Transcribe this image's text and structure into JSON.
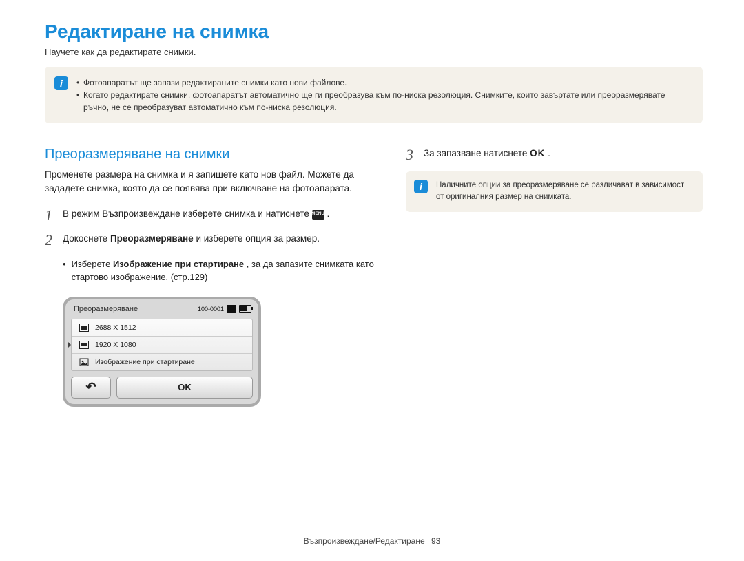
{
  "title": "Редактиране на снимка",
  "subtitle": "Научете как да редактирате снимки.",
  "top_note": {
    "items": [
      "Фотоапаратът ще запази редактираните снимки като нови файлове.",
      "Когато редактирате снимки, фотоапаратът автоматично ще ги преобразува към по-ниска резолюция. Снимките, които завъртате или преоразмерявате ръчно, не се преобразуват автоматично към по-ниска резолюция."
    ]
  },
  "left": {
    "section_title": "Преоразмеряване на снимки",
    "intro": "Променете размера на снимка и я запишете като нов файл. Можете да зададете снимка, която да се появява при включване на фотоапарата.",
    "step1_pre": "В режим Възпроизвеждане изберете снимка и натиснете ",
    "step1_menu": "MENU",
    "step1_post": " .",
    "step2_pre": "Докоснете ",
    "step2_bold": "Преоразмеряване",
    "step2_post": " и изберете опция за размер.",
    "sub_pre": "Изберете ",
    "sub_bold": "Изображение при стартиране",
    "sub_post": ", за да запазите снимката като стартово изображение. (стр.129)"
  },
  "right": {
    "step3_pre": "За запазване натиснете ",
    "step3_ok": "OK",
    "step3_post": " .",
    "note": "Наличните опции за преоразмеряване се различават в зависимост от оригиналния размер на снимката."
  },
  "device": {
    "header": "Преоразмеряване",
    "counter": "100-0001",
    "opt1": "2688 X 1512",
    "opt2": "1920 X 1080",
    "opt3": "Изображение при стартиране",
    "back": "↶",
    "ok": "OK"
  },
  "icons": {
    "note_glyph": "i"
  },
  "footer": {
    "section": "Възпроизвеждане/Редактиране",
    "page": "93"
  }
}
